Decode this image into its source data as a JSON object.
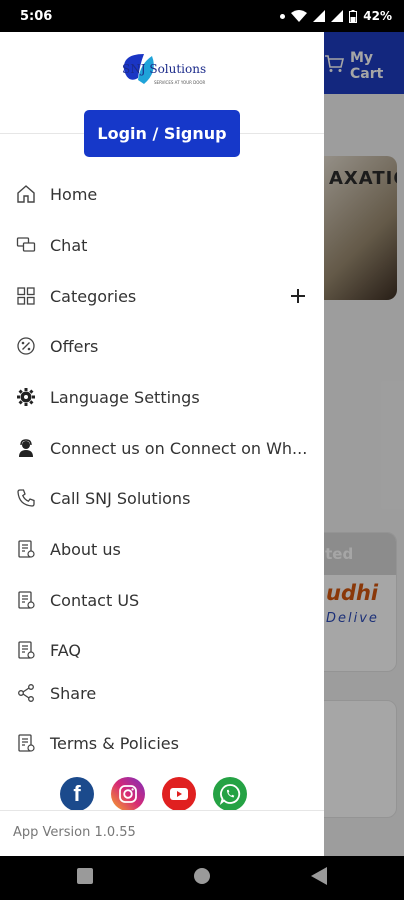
{
  "status_bar": {
    "time": "5:06",
    "battery": "42%"
  },
  "background": {
    "cart_label": "My Cart",
    "banner_text": "AXATIO",
    "banner2_label": "ited",
    "banner2_brand": "udhi",
    "banner2_sub": "Delive"
  },
  "drawer": {
    "logo_text": "SNJ Solutions",
    "logo_tagline": "SERVICES AT YOUR DOOR",
    "login_label": "Login / Signup",
    "items": [
      {
        "label": "Home",
        "icon": "home-icon"
      },
      {
        "label": "Chat",
        "icon": "chat-icon"
      },
      {
        "label": "Categories",
        "icon": "grid-icon"
      },
      {
        "label": "Offers",
        "icon": "percent-icon"
      },
      {
        "label": "Language Settings",
        "icon": "gear-icon"
      },
      {
        "label": "Connect us on Connect on Wh...",
        "icon": "agent-icon"
      },
      {
        "label": "Call SNJ Solutions",
        "icon": "phone-icon"
      },
      {
        "label": "About us",
        "icon": "document-icon"
      },
      {
        "label": "Contact US",
        "icon": "document-icon"
      },
      {
        "label": "FAQ",
        "icon": "document-icon"
      },
      {
        "label": "Share",
        "icon": "share-icon"
      },
      {
        "label": "Terms & Policies",
        "icon": "document-icon"
      }
    ],
    "socials": [
      {
        "name": "facebook-icon",
        "color": "#1b4a8c",
        "glyph": "f"
      },
      {
        "name": "instagram-icon",
        "color": "#d62976",
        "glyph": ""
      },
      {
        "name": "youtube-icon",
        "color": "#e02020",
        "glyph": ""
      },
      {
        "name": "whatsapp-icon",
        "color": "#25a244",
        "glyph": ""
      }
    ],
    "version": "App Version 1.0.55"
  },
  "colors": {
    "primary": "#1638c9",
    "header": "#1e3cc2"
  }
}
